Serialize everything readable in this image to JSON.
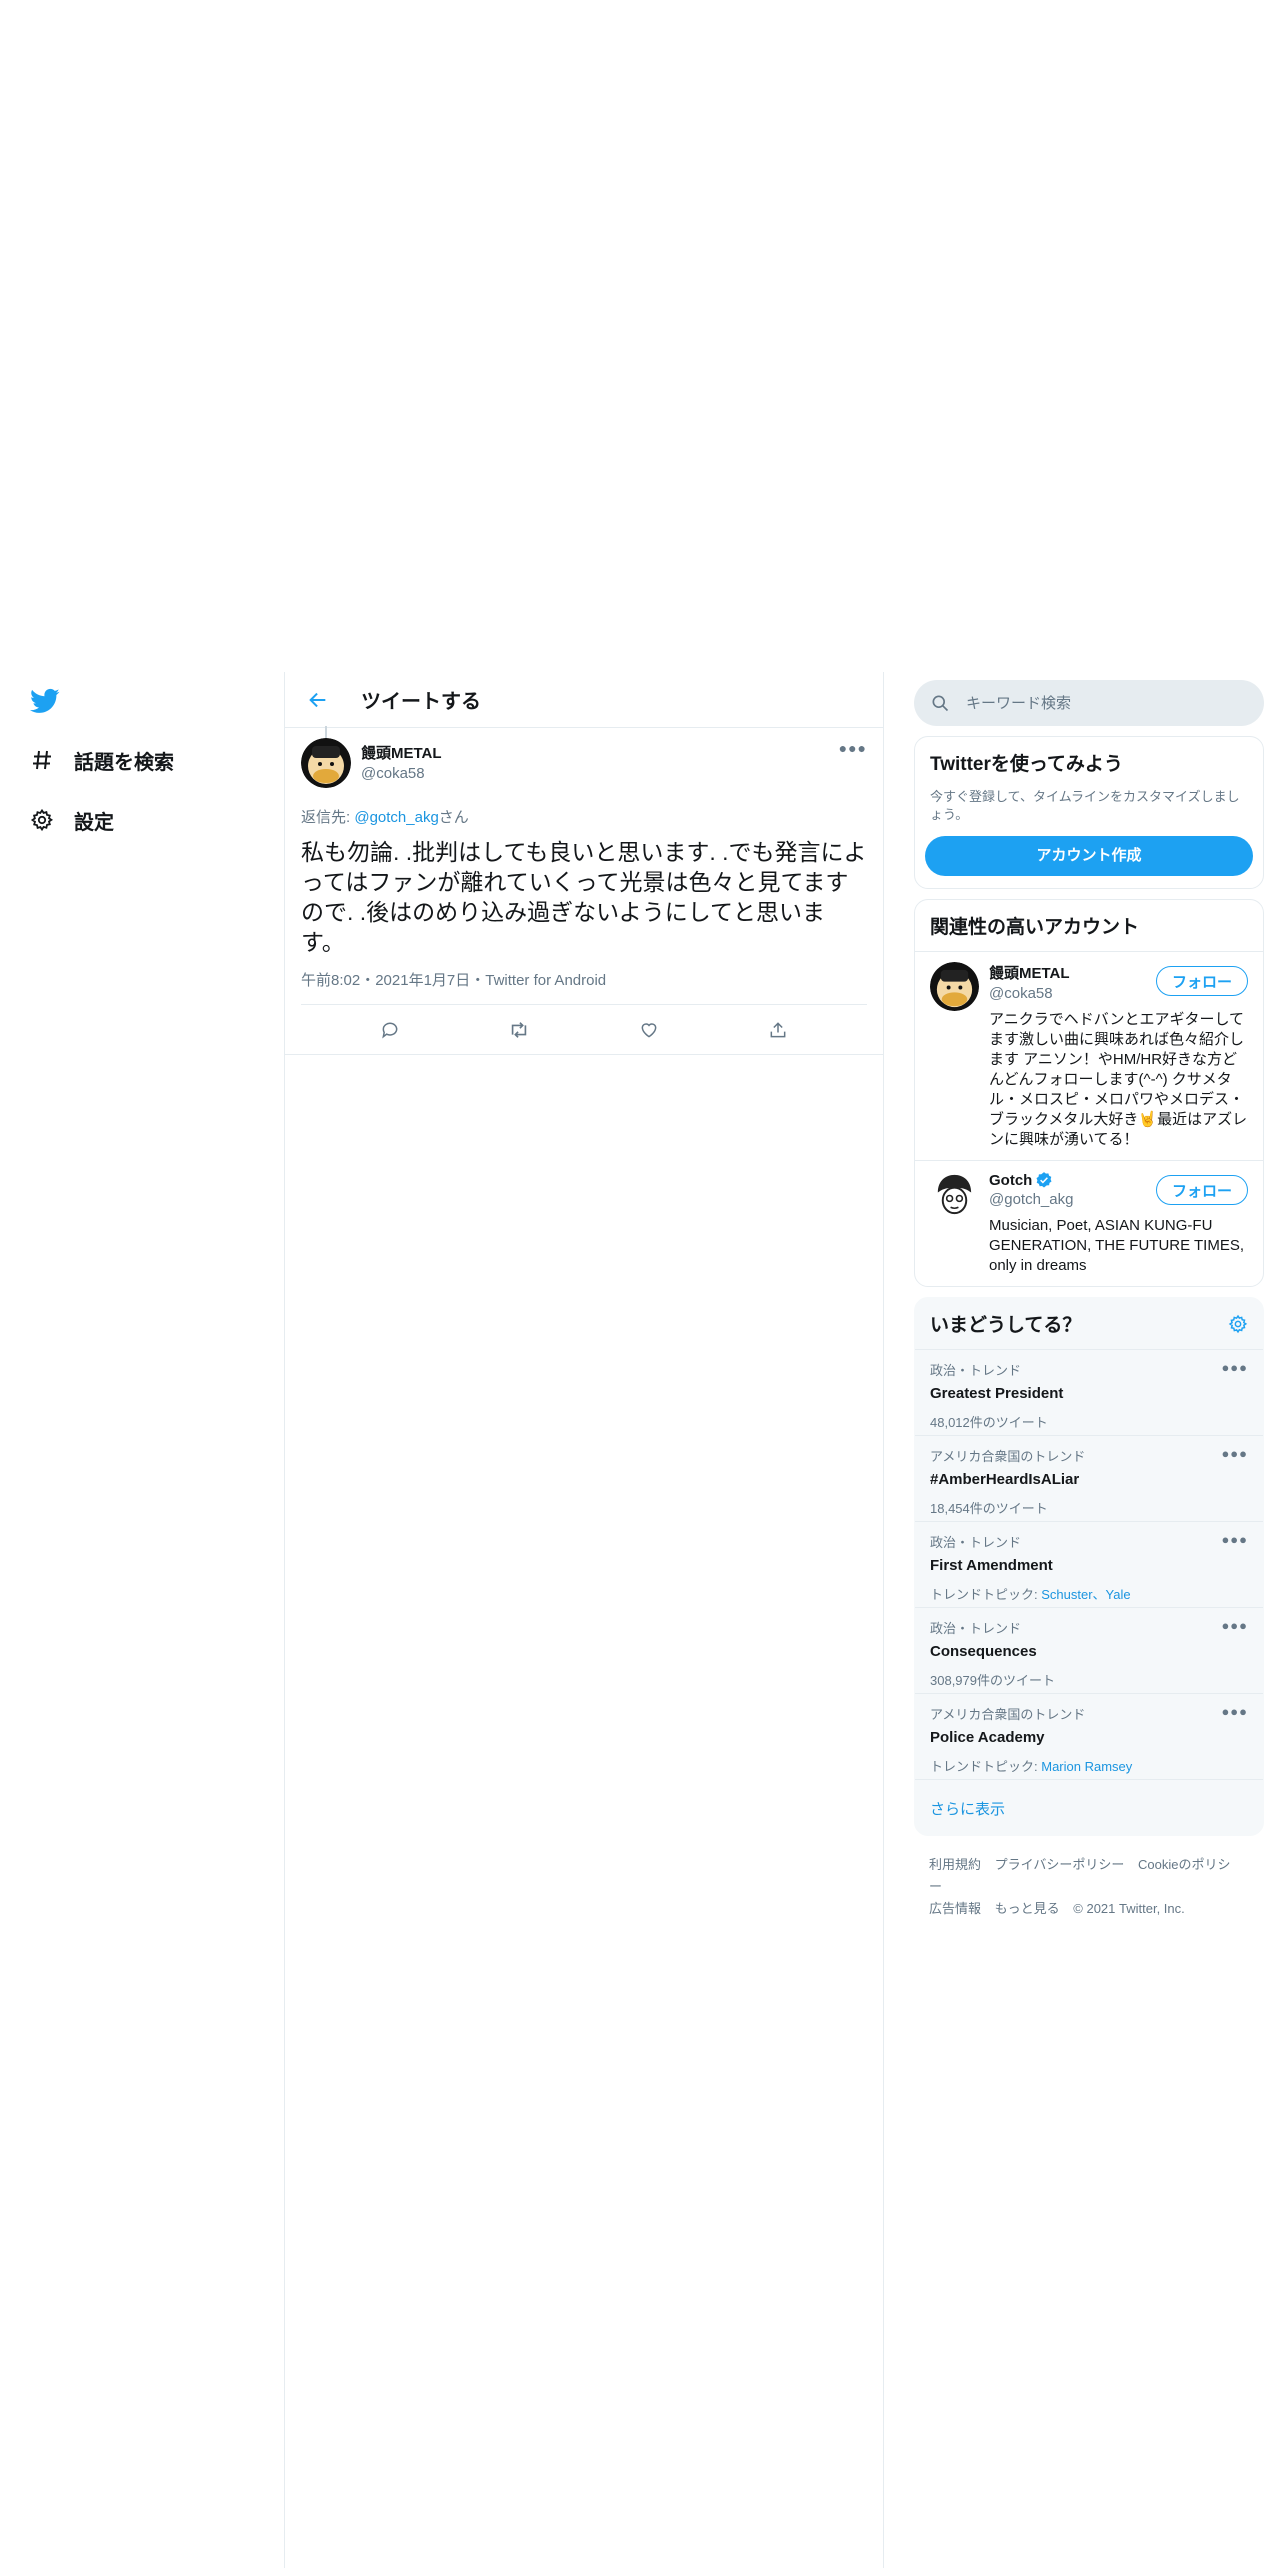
{
  "nav": {
    "explore_label": "話題を検索",
    "settings_label": "設定"
  },
  "header": {
    "title": "ツイートする"
  },
  "tweet": {
    "author_name": "饅頭METAL",
    "author_handle": "@coka58",
    "reply_prefix": "返信先: ",
    "reply_mention": "@gotch_akg",
    "reply_suffix": "さん",
    "text": "私も勿論. .批判はしても良いと思います. .でも発言によってはファンが離れていくって光景は色々と見てますので. .後はのめり込み過ぎないようにしてと思います。",
    "meta": "午前8:02・2021年1月7日・Twitter for Android"
  },
  "search": {
    "placeholder": "キーワード検索"
  },
  "signup": {
    "title": "Twitterを使ってみよう",
    "desc": "今すぐ登録して、タイムラインをカスタマイズしましょう。",
    "button": "アカウント作成"
  },
  "related": {
    "title": "関連性の高いアカウント",
    "follow_label": "フォロー",
    "accounts": [
      {
        "name": "饅頭METAL",
        "handle": "@coka58",
        "bio": "アニクラでヘドバンとエアギターしてます激しい曲に興味あれば色々紹介します アニソン！やHM/HR好きな方どんどんフォローします(^-^) クサメタル・メロスピ・メロパワやメロデス・ブラックメタル大好き🤘最近はアズレンに興味が湧いてる！"
      },
      {
        "name": "Gotch",
        "handle": "@gotch_akg",
        "bio": "Musician, Poet, ASIAN KUNG-FU GENERATION, THE FUTURE TIMES, only in dreams"
      }
    ]
  },
  "trends": {
    "title": "いまどうしてる？",
    "show_more": "さらに表示",
    "items": [
      {
        "category": "政治・トレンド",
        "name": "Greatest President",
        "count": "48,012件のツイート"
      },
      {
        "category": "アメリカ合衆国のトレンド",
        "name": "#AmberHeardIsALiar",
        "count": "18,454件のツイート"
      },
      {
        "category": "政治・トレンド",
        "name": "First Amendment",
        "topic_prefix": "トレンドトピック: ",
        "topics": "Schuster、Yale"
      },
      {
        "category": "政治・トレンド",
        "name": "Consequences",
        "count": "308,979件のツイート"
      },
      {
        "category": "アメリカ合衆国のトレンド",
        "name": "Police Academy",
        "topic_prefix": "トレンドトピック: ",
        "topics": "Marion Ramsey"
      }
    ]
  },
  "footer": {
    "terms": "利用規約",
    "privacy": "プライバシーポリシー",
    "cookies": "Cookieのポリシー",
    "ads": "広告情報",
    "more": "もっと見る",
    "copyright": "© 2021 Twitter, Inc."
  },
  "colors": {
    "accent": "#1da1f2",
    "link": "#1b95e0",
    "secondary_text": "#657786",
    "border": "#e6ecf0"
  },
  "icons": [
    "twitter-bird-icon",
    "hashtag-icon",
    "gear-icon",
    "back-arrow-icon",
    "more-icon",
    "reply-icon",
    "retweet-icon",
    "like-icon",
    "share-icon",
    "search-icon",
    "verified-icon"
  ]
}
